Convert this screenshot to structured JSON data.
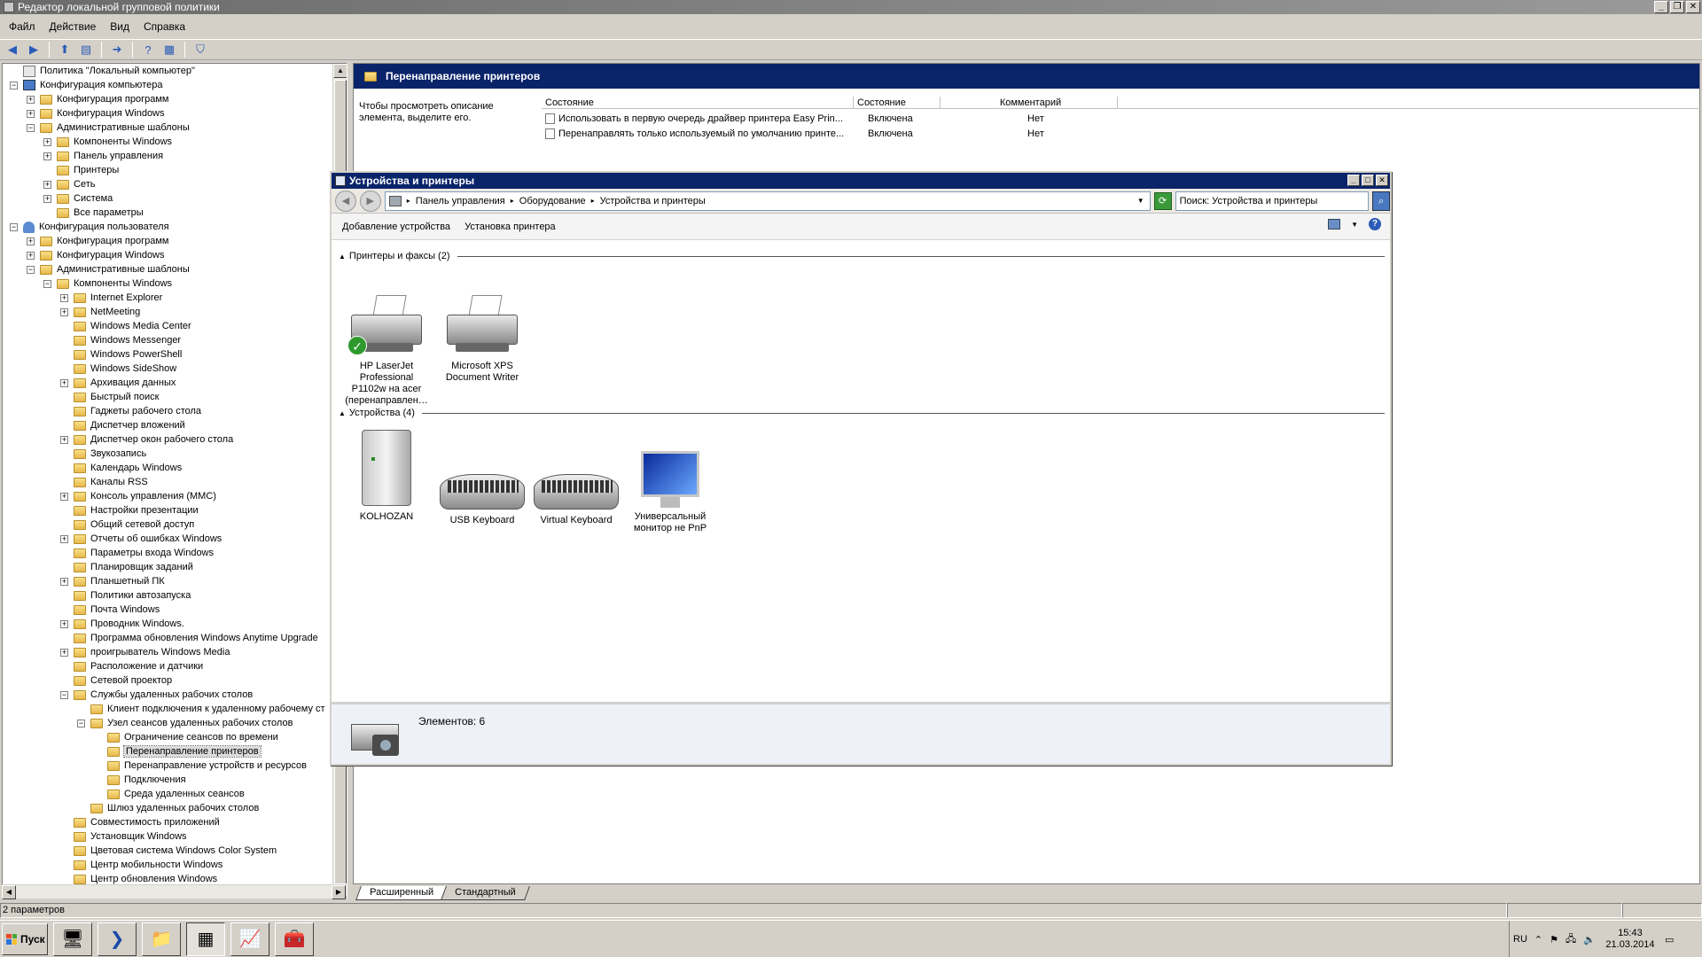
{
  "window": {
    "title": "Редактор локальной групповой политики"
  },
  "menu": [
    "Файл",
    "Действие",
    "Вид",
    "Справка"
  ],
  "tree": {
    "rows": [
      {
        "label": "Политика \"Локальный компьютер\"",
        "level": 0,
        "exp": "",
        "icon": "root"
      },
      {
        "label": "Конфигурация компьютера",
        "level": 0,
        "exp": "−",
        "icon": "computer"
      },
      {
        "label": "Конфигурация программ",
        "level": 1,
        "exp": "+",
        "icon": "folder"
      },
      {
        "label": "Конфигурация Windows",
        "level": 1,
        "exp": "+",
        "icon": "folder"
      },
      {
        "label": "Административные шаблоны",
        "level": 1,
        "exp": "−",
        "icon": "folder"
      },
      {
        "label": "Компоненты Windows",
        "level": 2,
        "exp": "+",
        "icon": "folder"
      },
      {
        "label": "Панель управления",
        "level": 2,
        "exp": "+",
        "icon": "folder"
      },
      {
        "label": "Принтеры",
        "level": 2,
        "exp": "",
        "icon": "folder"
      },
      {
        "label": "Сеть",
        "level": 2,
        "exp": "+",
        "icon": "folder"
      },
      {
        "label": "Система",
        "level": 2,
        "exp": "+",
        "icon": "folder"
      },
      {
        "label": "Все параметры",
        "level": 2,
        "exp": "",
        "icon": "folder"
      },
      {
        "label": "Конфигурация пользователя",
        "level": 0,
        "exp": "−",
        "icon": "user"
      },
      {
        "label": "Конфигурация программ",
        "level": 1,
        "exp": "+",
        "icon": "folder"
      },
      {
        "label": "Конфигурация Windows",
        "level": 1,
        "exp": "+",
        "icon": "folder"
      },
      {
        "label": "Административные шаблоны",
        "level": 1,
        "exp": "−",
        "icon": "folder"
      },
      {
        "label": "Компоненты Windows",
        "level": 2,
        "exp": "−",
        "icon": "folder"
      },
      {
        "label": "Internet Explorer",
        "level": 3,
        "exp": "+",
        "icon": "folder"
      },
      {
        "label": "NetMeeting",
        "level": 3,
        "exp": "+",
        "icon": "folder"
      },
      {
        "label": "Windows Media Center",
        "level": 3,
        "exp": "",
        "icon": "folder"
      },
      {
        "label": "Windows Messenger",
        "level": 3,
        "exp": "",
        "icon": "folder"
      },
      {
        "label": "Windows PowerShell",
        "level": 3,
        "exp": "",
        "icon": "folder"
      },
      {
        "label": "Windows SideShow",
        "level": 3,
        "exp": "",
        "icon": "folder"
      },
      {
        "label": "Архивация данных",
        "level": 3,
        "exp": "+",
        "icon": "folder"
      },
      {
        "label": "Быстрый поиск",
        "level": 3,
        "exp": "",
        "icon": "folder"
      },
      {
        "label": "Гаджеты рабочего стола",
        "level": 3,
        "exp": "",
        "icon": "folder"
      },
      {
        "label": "Диспетчер вложений",
        "level": 3,
        "exp": "",
        "icon": "folder"
      },
      {
        "label": "Диспетчер окон рабочего стола",
        "level": 3,
        "exp": "+",
        "icon": "folder"
      },
      {
        "label": "Звукозапись",
        "level": 3,
        "exp": "",
        "icon": "folder"
      },
      {
        "label": "Календарь Windows",
        "level": 3,
        "exp": "",
        "icon": "folder"
      },
      {
        "label": "Каналы RSS",
        "level": 3,
        "exp": "",
        "icon": "folder"
      },
      {
        "label": "Консоль управления (MMC)",
        "level": 3,
        "exp": "+",
        "icon": "folder"
      },
      {
        "label": "Настройки презентации",
        "level": 3,
        "exp": "",
        "icon": "folder"
      },
      {
        "label": "Общий сетевой доступ",
        "level": 3,
        "exp": "",
        "icon": "folder"
      },
      {
        "label": "Отчеты об ошибках Windows",
        "level": 3,
        "exp": "+",
        "icon": "folder"
      },
      {
        "label": "Параметры входа Windows",
        "level": 3,
        "exp": "",
        "icon": "folder"
      },
      {
        "label": "Планировщик заданий",
        "level": 3,
        "exp": "",
        "icon": "folder"
      },
      {
        "label": "Планшетный ПК",
        "level": 3,
        "exp": "+",
        "icon": "folder"
      },
      {
        "label": "Политики автозапуска",
        "level": 3,
        "exp": "",
        "icon": "folder"
      },
      {
        "label": "Почта Windows",
        "level": 3,
        "exp": "",
        "icon": "folder"
      },
      {
        "label": "Проводник Windows.",
        "level": 3,
        "exp": "+",
        "icon": "folder"
      },
      {
        "label": "Программа обновления Windows Anytime Upgrade",
        "level": 3,
        "exp": "",
        "icon": "folder"
      },
      {
        "label": "проигрыватель Windows Media",
        "level": 3,
        "exp": "+",
        "icon": "folder"
      },
      {
        "label": "Расположение и датчики",
        "level": 3,
        "exp": "",
        "icon": "folder"
      },
      {
        "label": "Сетевой проектор",
        "level": 3,
        "exp": "",
        "icon": "folder"
      },
      {
        "label": "Службы удаленных рабочих столов",
        "level": 3,
        "exp": "−",
        "icon": "folder"
      },
      {
        "label": "Клиент подключения к удаленному рабочему ст",
        "level": 4,
        "exp": "",
        "icon": "folder"
      },
      {
        "label": "Узел сеансов удаленных рабочих столов",
        "level": 4,
        "exp": "−",
        "icon": "folder"
      },
      {
        "label": "Ограничение сеансов по времени",
        "level": 5,
        "exp": "",
        "icon": "folder"
      },
      {
        "label": "Перенаправление принтеров",
        "level": 5,
        "exp": "",
        "icon": "folder",
        "selected": true
      },
      {
        "label": "Перенаправление устройств и ресурсов",
        "level": 5,
        "exp": "",
        "icon": "folder"
      },
      {
        "label": "Подключения",
        "level": 5,
        "exp": "",
        "icon": "folder"
      },
      {
        "label": "Среда удаленных сеансов",
        "level": 5,
        "exp": "",
        "icon": "folder"
      },
      {
        "label": "Шлюз удаленных рабочих столов",
        "level": 4,
        "exp": "",
        "icon": "folder"
      },
      {
        "label": "Совместимость приложений",
        "level": 3,
        "exp": "",
        "icon": "folder"
      },
      {
        "label": "Установщик Windows",
        "level": 3,
        "exp": "",
        "icon": "folder"
      },
      {
        "label": "Цветовая система Windows Color System",
        "level": 3,
        "exp": "",
        "icon": "folder"
      },
      {
        "label": "Центр мобильности Windows",
        "level": 3,
        "exp": "",
        "icon": "folder"
      },
      {
        "label": "Центр обновления Windows",
        "level": 3,
        "exp": "",
        "icon": "folder"
      }
    ]
  },
  "right": {
    "header": "Перенаправление принтеров",
    "description": "Чтобы просмотреть описание элемента, выделите его.",
    "columns": [
      "Состояние",
      "Состояние",
      "Комментарий"
    ],
    "rows": [
      {
        "name": "Использовать в первую очередь драйвер принтера Easy Prin...",
        "state": "Включена",
        "comment": "Нет"
      },
      {
        "name": "Перенаправлять только используемый по умолчанию принте...",
        "state": "Включена",
        "comment": "Нет"
      }
    ],
    "tabs": [
      "Расширенный",
      "Стандартный"
    ]
  },
  "status": {
    "text": "2 параметров"
  },
  "dialog": {
    "title": "Устройства и принтеры",
    "breadcrumb": [
      "Панель управления",
      "Оборудование",
      "Устройства и принтеры"
    ],
    "search_placeholder": "Поиск: Устройства и принтеры",
    "commands": [
      "Добавление устройства",
      "Установка принтера"
    ],
    "groups": [
      {
        "title": "Принтеры и факсы (2)"
      },
      {
        "title": "Устройства (4)"
      }
    ],
    "printers": [
      {
        "label": "HP LaserJet Professional P1102w на acer (перенаправлен…",
        "default": true
      },
      {
        "label": "Microsoft XPS Document Writer",
        "default": false
      }
    ],
    "devices": [
      {
        "label": "KOLHOZAN",
        "icon": "computer-tower-icon"
      },
      {
        "label": "USB Keyboard",
        "icon": "keyboard-icon"
      },
      {
        "label": "Virtual Keyboard",
        "icon": "keyboard-icon"
      },
      {
        "label": "Универсальный монитор не PnP",
        "icon": "monitor-icon"
      }
    ],
    "footer": "Элементов: 6"
  },
  "taskbar": {
    "start": "Пуск",
    "lang": "RU",
    "time": "15:43",
    "date": "21.03.2014"
  }
}
